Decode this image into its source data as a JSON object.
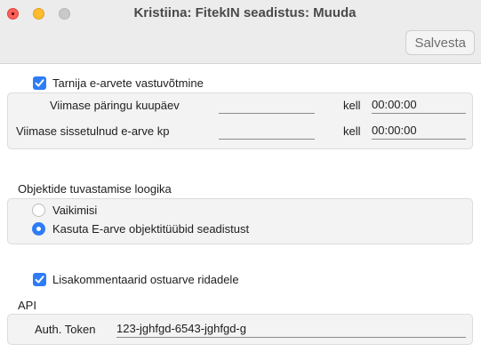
{
  "window": {
    "title": "Kristiina: FitekIN seadistus: Muuda"
  },
  "toolbar": {
    "save_label": "Salvesta"
  },
  "einvoice": {
    "enable_label": "Tarnija e-arvete vastuvõtmine",
    "enable_checked": true,
    "last_query_date_label": "Viimase päringu kuupäev",
    "last_query_date_value": "",
    "last_query_time_label": "kell",
    "last_query_time_value": "00:00:00",
    "last_received_label": "Viimase sissetulnud e-arve kp",
    "last_received_value": "",
    "last_received_time_label": "kell",
    "last_received_time_value": "00:00:00"
  },
  "object_logic": {
    "heading": "Objektide tuvastamise loogika",
    "options": [
      {
        "label": "Vaikimisi",
        "selected": false
      },
      {
        "label": "Kasuta E-arve objektitüübid seadistust",
        "selected": true
      }
    ]
  },
  "comments": {
    "label": "Lisakommentaarid ostuarve ridadele",
    "checked": true
  },
  "api": {
    "heading": "API",
    "token_label": "Auth. Token",
    "token_value": "123-jghfgd-6543-jghfgd-g"
  },
  "colors": {
    "accent": "#2d7cf6",
    "titlebar": "#ececec",
    "panel": "#f3f3f3"
  }
}
